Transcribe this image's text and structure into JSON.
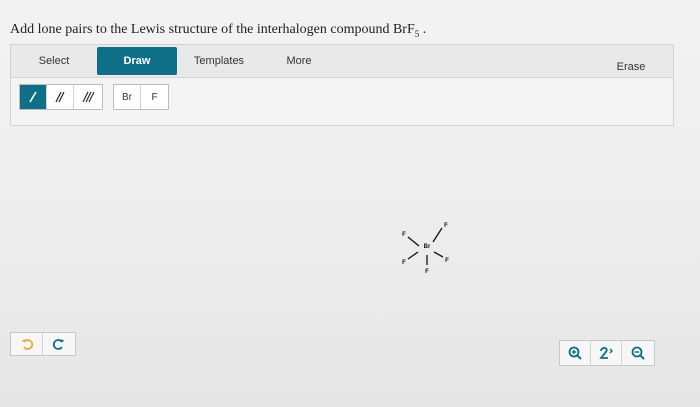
{
  "question": {
    "text": "Add lone pairs to the Lewis structure of the interhalogen compound BrF",
    "subscript": "5",
    "suffix": " ."
  },
  "tabs": {
    "select": "Select",
    "draw": "Draw",
    "templates": "Templates",
    "more": "More",
    "erase": "Erase"
  },
  "bond_tools": [
    {
      "name": "single-bond",
      "icon": "single-bond-icon"
    },
    {
      "name": "double-bond",
      "icon": "double-bond-icon"
    },
    {
      "name": "triple-bond",
      "icon": "triple-bond-icon"
    }
  ],
  "atom_tools": [
    "Br",
    "F"
  ],
  "molecule": {
    "center_atom": "Br",
    "ligand_atoms": [
      "F",
      "F",
      "F",
      "F",
      "F"
    ]
  },
  "history": {
    "undo_icon": "undo-icon",
    "redo_icon": "redo-icon"
  },
  "zoom": {
    "zoom_in_icon": "zoom-in-icon",
    "reset_icon": "reset-zoom-icon",
    "zoom_out_icon": "zoom-out-icon"
  },
  "colors": {
    "accent": "#0f6f86",
    "history_undo": "#e8a93a",
    "history_redo": "#0f6f86"
  }
}
